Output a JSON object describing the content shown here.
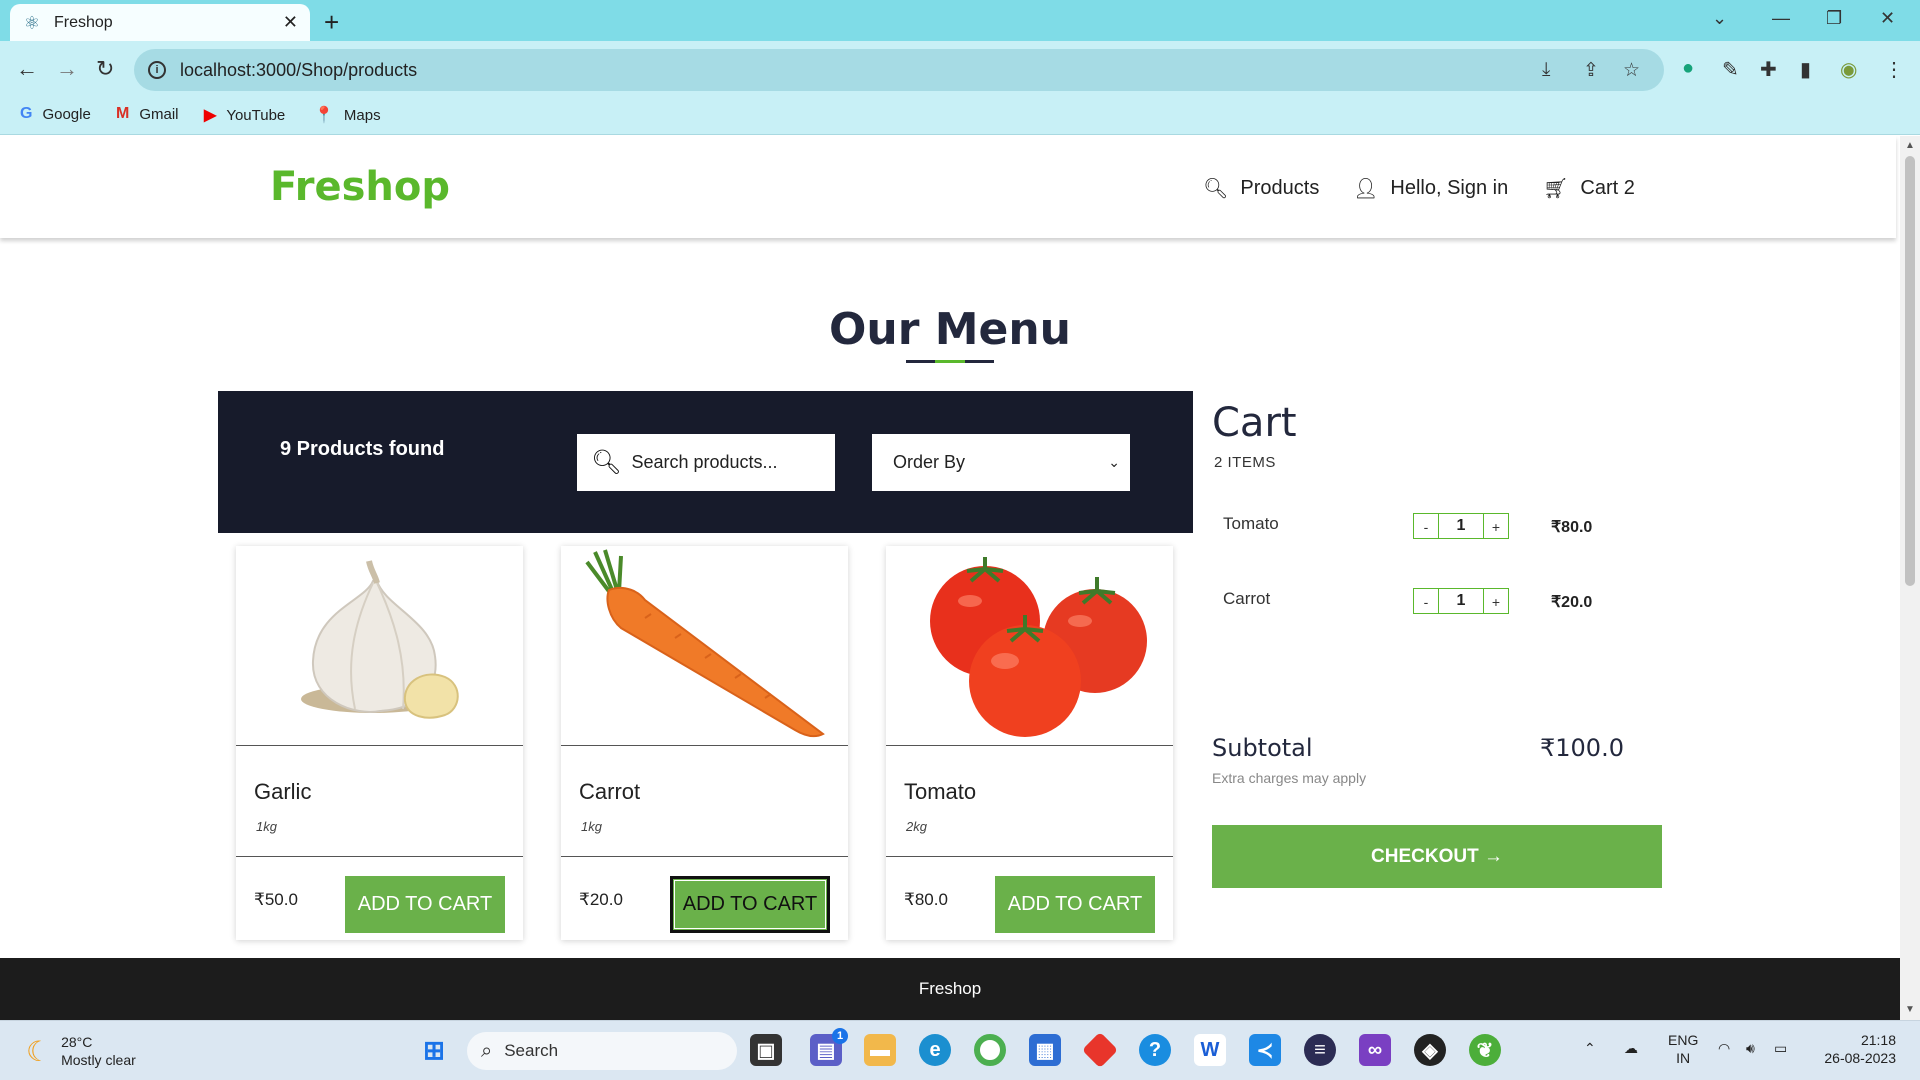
{
  "browser": {
    "tab_title": "Freshop",
    "url": "localhost:3000/Shop/products",
    "bookmarks": [
      {
        "label": "Google"
      },
      {
        "label": "Gmail"
      },
      {
        "label": "YouTube"
      },
      {
        "label": "Maps"
      }
    ]
  },
  "header": {
    "logo": "Freshop",
    "nav": {
      "products": "Products",
      "signin": "Hello, Sign in",
      "cart": "Cart 2"
    }
  },
  "menu": {
    "title": "Our Menu",
    "found": "9 Products found",
    "search_placeholder": "Search products...",
    "order_by": "Order By"
  },
  "products": [
    {
      "name": "Garlic",
      "weight": "1kg",
      "price": "₹50.0",
      "button": "ADD TO CART"
    },
    {
      "name": "Carrot",
      "weight": "1kg",
      "price": "₹20.0",
      "button": "ADD TO CART"
    },
    {
      "name": "Tomato",
      "weight": "2kg",
      "price": "₹80.0",
      "button": "ADD TO CART"
    }
  ],
  "cart": {
    "title": "Cart",
    "count": "2 ITEMS",
    "items": [
      {
        "name": "Tomato",
        "qty": "1",
        "price": "₹80.0"
      },
      {
        "name": "Carrot",
        "qty": "1",
        "price": "₹20.0"
      }
    ],
    "subtotal_label": "Subtotal",
    "subtotal_value": "₹100.0",
    "extra": "Extra charges may apply",
    "checkout": "CHECKOUT →"
  },
  "footer": {
    "text": "Freshop"
  },
  "taskbar": {
    "temp": "28°C",
    "weather": "Mostly clear",
    "search": "Search",
    "lang": "ENG",
    "region": "IN",
    "time": "21:18",
    "date": "26-08-2023",
    "chat_badge": "1"
  },
  "colors": {
    "brand": "#5ab82c",
    "button": "#6ab14a",
    "dark": "#171b2b"
  }
}
